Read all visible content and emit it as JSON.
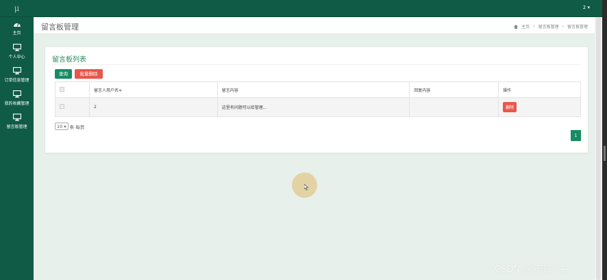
{
  "sidebar": {
    "logo": "μ",
    "items": [
      {
        "label": "主页",
        "icon": "dashboard-icon"
      },
      {
        "label": "个人中心",
        "icon": "monitor-icon"
      },
      {
        "label": "订单信息管理",
        "icon": "monitor-icon"
      },
      {
        "label": "我的收藏管理",
        "icon": "monitor-icon"
      },
      {
        "label": "留言板管理",
        "icon": "monitor-icon"
      }
    ]
  },
  "topbar": {
    "user": "2 ▾"
  },
  "header": {
    "title": "留言板管理",
    "breadcrumb": [
      "主页",
      "留言板管理",
      "留言板管理"
    ]
  },
  "card": {
    "title": "留言板列表",
    "search_label": "查询",
    "bulk_delete_label": "批量删除",
    "table": {
      "columns": [
        "",
        "留言人用户名≑",
        "留言内容",
        "回复内容",
        "操作"
      ],
      "rows": [
        {
          "username": "2",
          "content": "这里有问题可以给管理...",
          "reply": "",
          "action": "删除"
        }
      ]
    },
    "page_size": "10",
    "page_size_suffix": "条 每页",
    "current_page": "1"
  },
  "watermark": "CSDN @苏南学弟",
  "colors": {
    "primary": "#0f5b46",
    "accent": "#178b62",
    "danger": "#e8574c"
  }
}
